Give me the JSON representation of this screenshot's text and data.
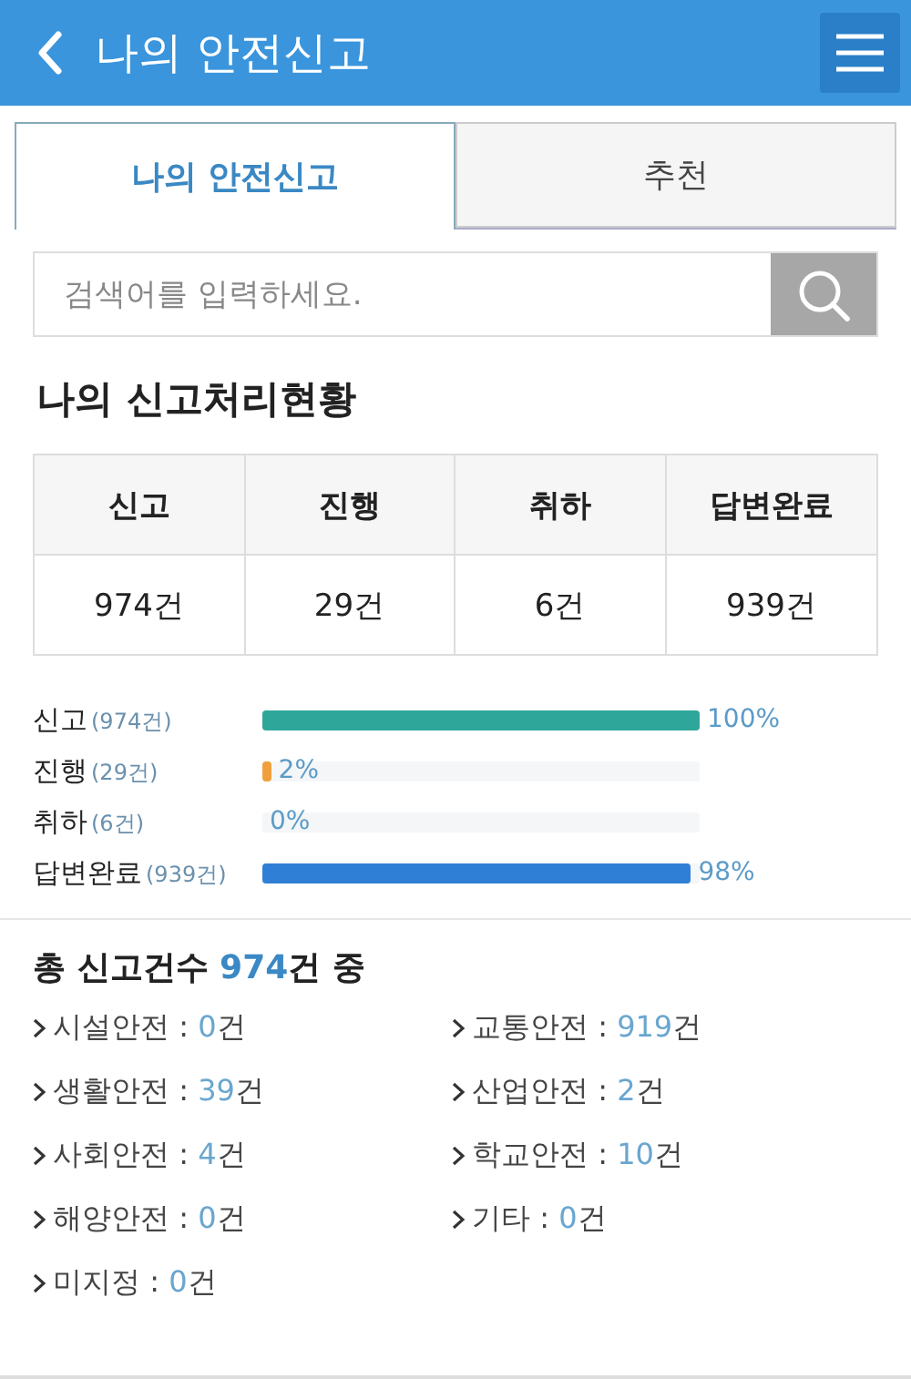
{
  "header": {
    "title": "나의 안전신고"
  },
  "tabs": [
    {
      "label": "나의 안전신고",
      "selected": true
    },
    {
      "label": "추천",
      "selected": false
    }
  ],
  "search": {
    "placeholder": "검색어를 입력하세요."
  },
  "status_title": "나의 신고처리현황",
  "stats_table": {
    "columns": [
      "신고",
      "진행",
      "취하",
      "답변완료"
    ],
    "values": [
      "974건",
      "29건",
      "6건",
      "939건"
    ]
  },
  "bars": [
    {
      "label": "신고",
      "count": "(974건)",
      "level": 1.0,
      "reading": "100%",
      "color": "#2fa69a"
    },
    {
      "label": "진행",
      "count": "(29건)",
      "level": 0.02,
      "reading": "2%",
      "color": "#f0a03c"
    },
    {
      "label": "취하",
      "count": "(6건)",
      "reading": "0%"
    },
    {
      "label": "답변완료",
      "count": "(939건)",
      "level": 0.98,
      "reading": "98%",
      "color": "#2f7fd6"
    }
  ],
  "summary": {
    "prefix": "총 신고건수",
    "count": "974",
    "suffix": "건 중"
  },
  "categories": [
    {
      "label": "시설안전 :",
      "count": "0",
      "unit": "건"
    },
    {
      "label": "교통안전 :",
      "count": "919",
      "unit": "건"
    },
    {
      "label": "생활안전 :",
      "count": "39",
      "unit": "건"
    },
    {
      "label": "산업안전 :",
      "count": "2",
      "unit": "건"
    },
    {
      "label": "사회안전 :",
      "count": "4",
      "unit": "건"
    },
    {
      "label": "학교안전 :",
      "count": "10",
      "unit": "건"
    },
    {
      "label": "해양안전 :",
      "count": "0",
      "unit": "건"
    },
    {
      "label": "기타 :",
      "count": "0",
      "unit": "건"
    },
    {
      "label": "미지정 :",
      "count": "0",
      "unit": "건"
    }
  ]
}
